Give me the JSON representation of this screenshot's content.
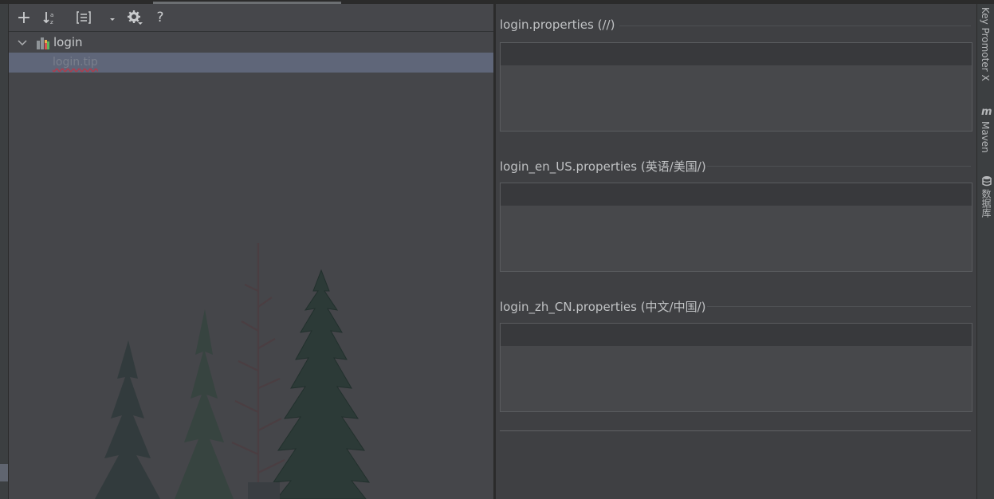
{
  "toolbar": {
    "add": "+",
    "help": "?"
  },
  "tree": {
    "root_label": "login",
    "child_label": "login.tip"
  },
  "sections": [
    {
      "title": "login.properties (//)"
    },
    {
      "title": "login_en_US.properties (英语/美国/)"
    },
    {
      "title": "login_zh_CN.properties (中文/中国/)"
    }
  ],
  "right_tools": {
    "key_promoter": "Key Promoter X",
    "maven": "Maven",
    "database": "数据库"
  },
  "colors": {
    "background": "#3c3f41",
    "selection": "#5f6679",
    "error_underline": "#b5394a"
  }
}
